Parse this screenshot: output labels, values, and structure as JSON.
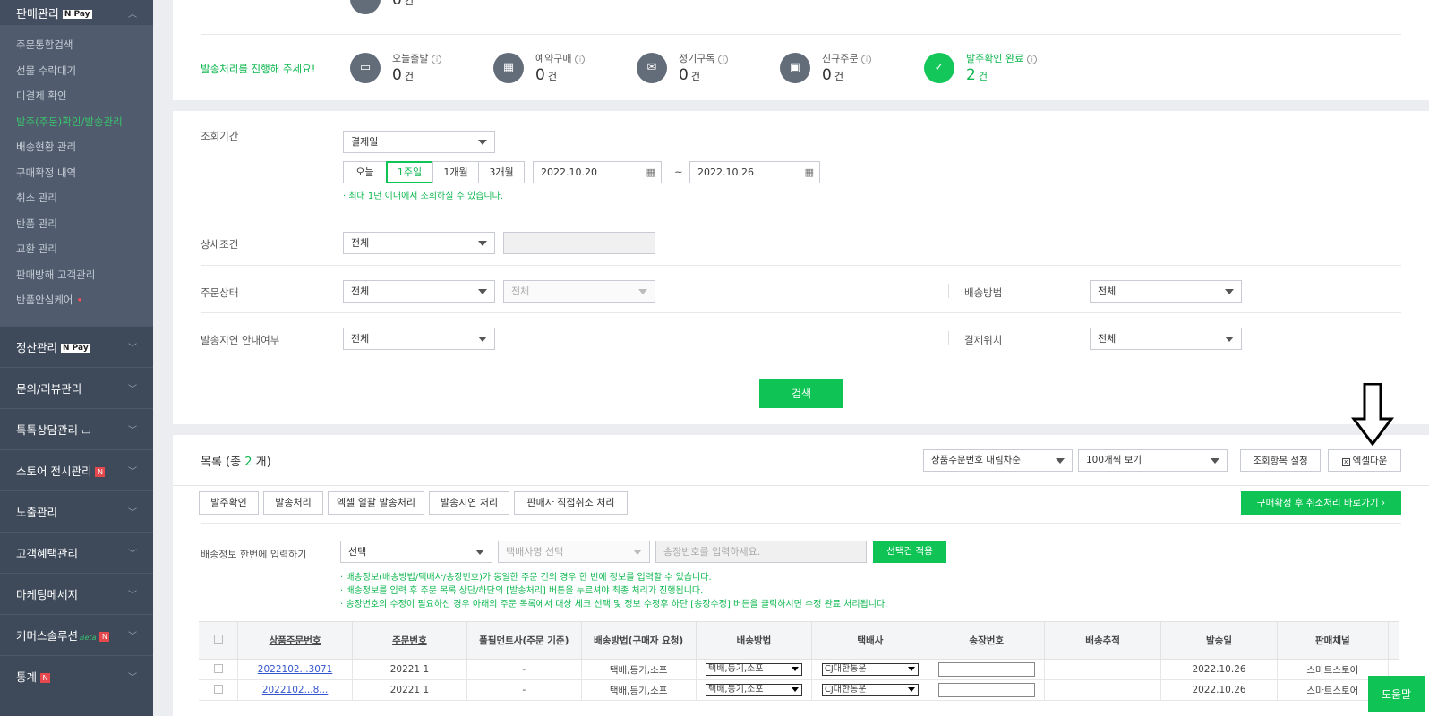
{
  "sidebar": {
    "top_title": "판매관리",
    "top_badge": "N Pay",
    "sub_items": [
      "주문통합검색",
      "선물 수락대기",
      "미결제 확인",
      "발주(주문)확인/발송관리",
      "배송현황 관리",
      "구매확정 내역",
      "취소 관리",
      "반품 관리",
      "교환 관리",
      "판매방해 고객관리",
      "반품안심케어"
    ],
    "menus": [
      {
        "label": "정산관리",
        "badge": "N Pay"
      },
      {
        "label": "문의/리뷰관리"
      },
      {
        "label": "톡톡상담관리"
      },
      {
        "label": "스토어 전시관리",
        "badge": "N"
      },
      {
        "label": "노출관리"
      },
      {
        "label": "고객혜택관리"
      },
      {
        "label": "마케팅메세지"
      },
      {
        "label": "커머스솔루션",
        "beta": "Beta",
        "badge": "N"
      },
      {
        "label": "통계",
        "badge": "N"
      }
    ]
  },
  "stats": {
    "top_partial": {
      "value": "0",
      "unit": "건"
    },
    "prompt": "발송처리를 진행해 주세요!",
    "items": [
      {
        "label": "오늘출발",
        "value": "0",
        "unit": "건"
      },
      {
        "label": "예약구매",
        "value": "0",
        "unit": "건"
      },
      {
        "label": "정기구독",
        "value": "0",
        "unit": "건"
      },
      {
        "label": "신규주문",
        "value": "0",
        "unit": "건"
      },
      {
        "label": "발주확인 완료",
        "value": "2",
        "unit": "건"
      }
    ]
  },
  "search": {
    "period_label": "조회기간",
    "period_type": "결제일",
    "quick": [
      "오늘",
      "1주일",
      "1개월",
      "3개월"
    ],
    "date_from": "2022.10.20",
    "tilde": "~",
    "date_to": "2022.10.26",
    "period_note": "· 최대 1년 이내에서 조회하실 수 있습니다.",
    "detail_label": "상세조건",
    "detail_value": "전체",
    "status_label": "주문상태",
    "status_value": "전체",
    "status_sub": "전체",
    "ship_method_label": "배송방법",
    "ship_method_value": "전체",
    "delay_label": "발송지연 안내여부",
    "delay_value": "전체",
    "pay_loc_label": "결제위치",
    "pay_loc_value": "전체",
    "search_button": "검색"
  },
  "list": {
    "title_prefix": "목록 (총 ",
    "count": "2",
    "title_suffix": " 개)",
    "sort": "상품주문번호 내림차순",
    "page_size": "100개씩 보기",
    "column_settings": "조회항목 설정",
    "excel": "엑셀다운",
    "actions": [
      "발주확인",
      "발송처리",
      "엑셀 일괄 발송처리",
      "발송지연 처리",
      "판매자 직접취소 처리"
    ],
    "confirm_cancel": "구매확정 후 취소처리 바로가기 ›",
    "bulk_label": "배송정보 한번에 입력하기",
    "bulk_select": "선택",
    "courier_placeholder": "택배사명 선택",
    "tracking_placeholder": "송장번호를 입력하세요.",
    "apply_button": "선택건 적용",
    "notes": [
      "· 배송정보(배송방법/택배사/송장번호)가 동일한 주문 건의 경우 한 번에 정보를 입력할 수 있습니다.",
      "· 배송정보를 입력 후 주문 목록 상단/하단의 [발송처리] 버튼을 누르셔야 최종 처리가 진행됩니다.",
      "· 송장번호의 수정이 필요하신 경우 아래의 주문 목록에서 대상 체크 선택 및 정보 수정후 하단 [송장수정] 버튼을 클릭하시면 수정 완료 처리됩니다."
    ],
    "columns": [
      "상품주문번호",
      "주문번호",
      "풀필먼트사(주문 기준)",
      "배송방법(구매자 요청)",
      "배송방법",
      "택배사",
      "송장번호",
      "배송추적",
      "발송일",
      "판매채널"
    ],
    "rows": [
      {
        "product_no": "2022102...3071",
        "order_no": "20221    1",
        "fulfillment": "-",
        "req_method": "택배,등기,소포",
        "method": "택배,등기,소포",
        "courier": "CJ대한통운",
        "tracking": "",
        "trace": "",
        "ship_date": "2022.10.26",
        "channel": "스마트스토어"
      },
      {
        "product_no": "2022102...8...",
        "order_no": "20221    1",
        "fulfillment": "-",
        "req_method": "택배,등기,소포",
        "method": "택배,등기,소포",
        "courier": "CJ대한통운",
        "tracking": "",
        "trace": "",
        "ship_date": "2022.10.26",
        "channel": "스마트스토어"
      }
    ]
  },
  "help_button": "도움말"
}
